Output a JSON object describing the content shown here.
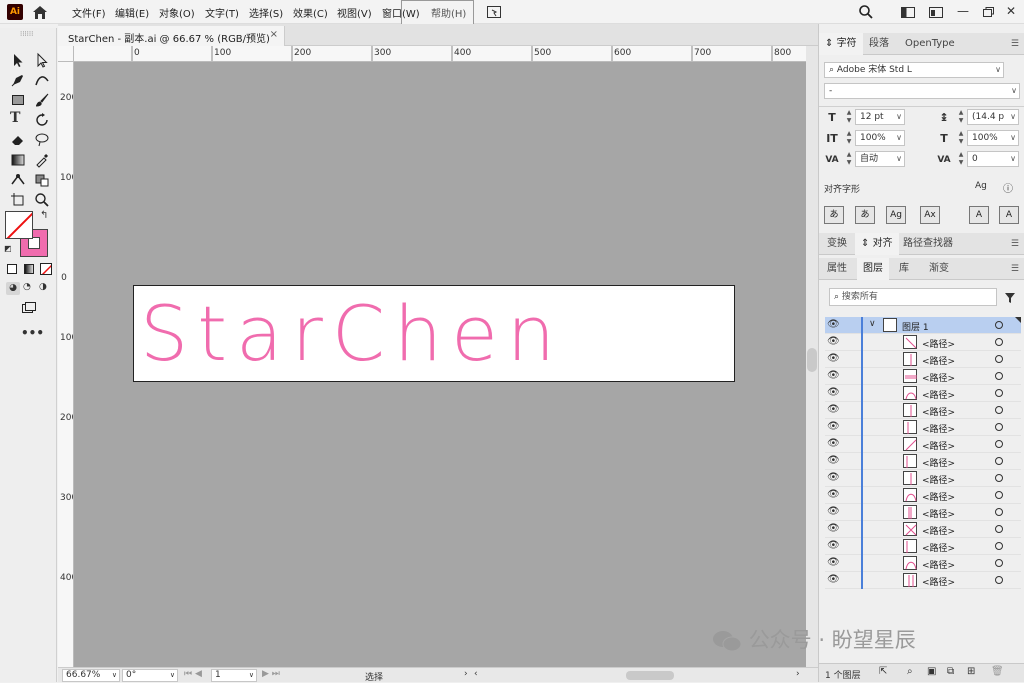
{
  "app": {
    "logo": "Ai"
  },
  "menu": {
    "items": [
      "文件(F)",
      "编辑(E)",
      "对象(O)",
      "文字(T)",
      "选择(S)",
      "效果(C)",
      "视图(V)",
      "窗口(W)",
      "帮助(H)"
    ]
  },
  "document": {
    "tab_title": "StarChen - 副本.ai @ 66.67 % (RGB/预览)",
    "close": "×",
    "artboard_text": "StarChen",
    "text_color": "#f06cae"
  },
  "rulers": {
    "top": [
      "0",
      "100",
      "200",
      "300",
      "400",
      "500",
      "600",
      "700",
      "800"
    ],
    "left": [
      "200",
      "100",
      "0",
      "100",
      "200",
      "300",
      "400"
    ]
  },
  "status": {
    "zoom": "66.67%",
    "rotation": "0°",
    "artboard_num": "1",
    "mode": "选择"
  },
  "char_panel": {
    "tabs": [
      "字符",
      "段落",
      "OpenType"
    ],
    "font_family": "Adobe 宋体 Std L",
    "font_style": "-",
    "font_size": "12 pt",
    "leading": "(14.4 p",
    "v_scale": "100%",
    "h_scale": "100%",
    "kerning": "自动",
    "tracking": "0",
    "align_glyphs_label": "对齐字形",
    "glyph_buttons": [
      "あ",
      "あ",
      "Ag",
      "Ax",
      "A",
      "A"
    ]
  },
  "align_panel": {
    "tabs": [
      "变换",
      "对齐",
      "路径查找器"
    ]
  },
  "layers_panel": {
    "tabs": [
      "属性",
      "图层",
      "库",
      "渐变"
    ],
    "search_placeholder": "搜索所有",
    "layer_name": "图层 1",
    "paths": [
      "<路径>",
      "<路径>",
      "<路径>",
      "<路径>",
      "<路径>",
      "<路径>",
      "<路径>",
      "<路径>",
      "<路径>",
      "<路径>",
      "<路径>",
      "<路径>",
      "<路径>",
      "<路径>",
      "<路径>"
    ],
    "footer_count": "1 个图层"
  },
  "watermark": "公众号 · 盼望星辰"
}
